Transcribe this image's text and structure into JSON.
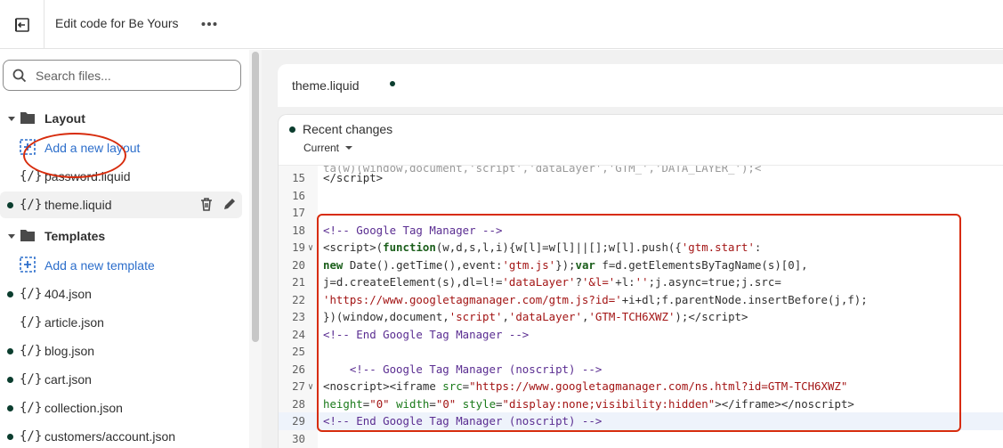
{
  "topbar": {
    "title": "Edit code for Be Yours",
    "exit_icon": "exit-icon",
    "more_icon": "ellipsis-icon"
  },
  "sidebar": {
    "search_placeholder": "Search files...",
    "layout_folder": "Layout",
    "add_layout": "Add a new layout",
    "templates_folder": "Templates",
    "add_template": "Add a new template",
    "files": {
      "password": "password.liquid",
      "theme": "theme.liquid",
      "f404": "404.json",
      "article": "article.json",
      "blog": "blog.json",
      "cart": "cart.json",
      "collection": "collection.json",
      "customers_account": "customers/account.json"
    },
    "file_icon_glyph": "{/}"
  },
  "editor": {
    "tab_label": "theme.liquid",
    "recent_changes": "Recent changes",
    "version": "Current",
    "line_numbers": [
      "15",
      "16",
      "17",
      "18",
      "19",
      "20",
      "21",
      "22",
      "23",
      "24",
      "25",
      "26",
      "27",
      "28",
      "29",
      "30"
    ]
  },
  "colors": {
    "accent": "#2c6ecb",
    "annotation": "#d72c0d",
    "dot": "#0b3d2e"
  }
}
